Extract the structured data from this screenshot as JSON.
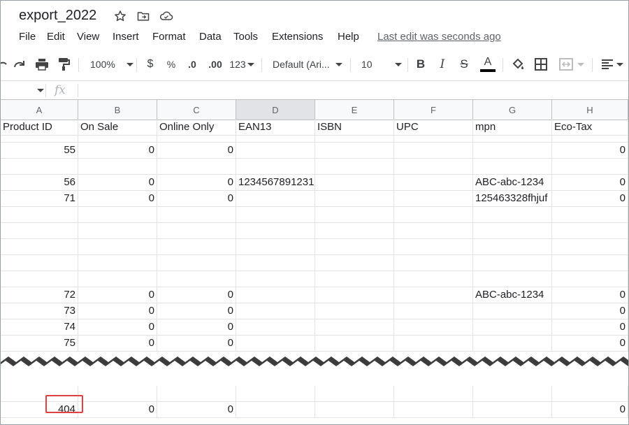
{
  "title_bar": {
    "doc_title": "export_2022",
    "icons": [
      "star-icon",
      "move-to-folder-icon",
      "cloud-status-icon"
    ]
  },
  "menu": {
    "items": [
      "File",
      "Edit",
      "View",
      "Insert",
      "Format",
      "Data",
      "Tools",
      "Extensions",
      "Help"
    ],
    "last_edit": "Last edit was seconds ago"
  },
  "toolbar": {
    "zoom": "100%",
    "currency": "$",
    "percent": "%",
    "decrease_decimal": ".0",
    "increase_decimal": ".00",
    "number_format": "123",
    "font": "Default (Ari...",
    "font_size": "10",
    "bold": "B",
    "italic": "I",
    "strike": "S",
    "text_color": "A",
    "accent_underline": "#000000"
  },
  "formula_bar": {
    "fx": "fx",
    "value": ""
  },
  "columns": [
    "A",
    "B",
    "C",
    "D",
    "E",
    "F",
    "G",
    "H"
  ],
  "selected_column": "D",
  "grid": {
    "header_row": [
      "Product ID",
      "On Sale",
      "Online Only",
      "EAN13",
      "ISBN",
      "UPC",
      "mpn",
      "Eco-Tax"
    ],
    "rows": [
      [
        "55",
        "0",
        "0",
        "",
        "",
        "",
        "",
        "0"
      ],
      [
        "",
        "",
        "",
        "",
        "",
        "",
        "",
        ""
      ],
      [
        "56",
        "0",
        "0",
        "1234567891231",
        "",
        "",
        "ABC-abc-1234",
        "0"
      ],
      [
        "71",
        "0",
        "0",
        "",
        "",
        "",
        "125463328fhjuf",
        "0"
      ],
      [
        "",
        "",
        "",
        "",
        "",
        "",
        "",
        ""
      ],
      [
        "",
        "",
        "",
        "",
        "",
        "",
        "",
        ""
      ],
      [
        "",
        "",
        "",
        "",
        "",
        "",
        "",
        ""
      ],
      [
        "",
        "",
        "",
        "",
        "",
        "",
        "",
        ""
      ],
      [
        "",
        "",
        "",
        "",
        "",
        "",
        "",
        ""
      ],
      [
        "72",
        "0",
        "0",
        "",
        "",
        "",
        "ABC-abc-1234",
        "0"
      ],
      [
        "73",
        "0",
        "0",
        "",
        "",
        "",
        "",
        "0"
      ],
      [
        "74",
        "0",
        "0",
        "",
        "",
        "",
        "",
        "0"
      ],
      [
        "75",
        "0",
        "0",
        "",
        "",
        "",
        "",
        "0"
      ]
    ],
    "after_break_rows": [
      [
        "",
        "",
        "",
        "",
        "",
        "",
        "",
        ""
      ],
      [
        "404",
        "0",
        "0",
        "",
        "",
        "",
        "",
        "0"
      ]
    ]
  },
  "colors": {
    "highlight_border": "#e04040",
    "selected_col_header": "#e1e3e6",
    "gridline": "#e2e3e3"
  }
}
